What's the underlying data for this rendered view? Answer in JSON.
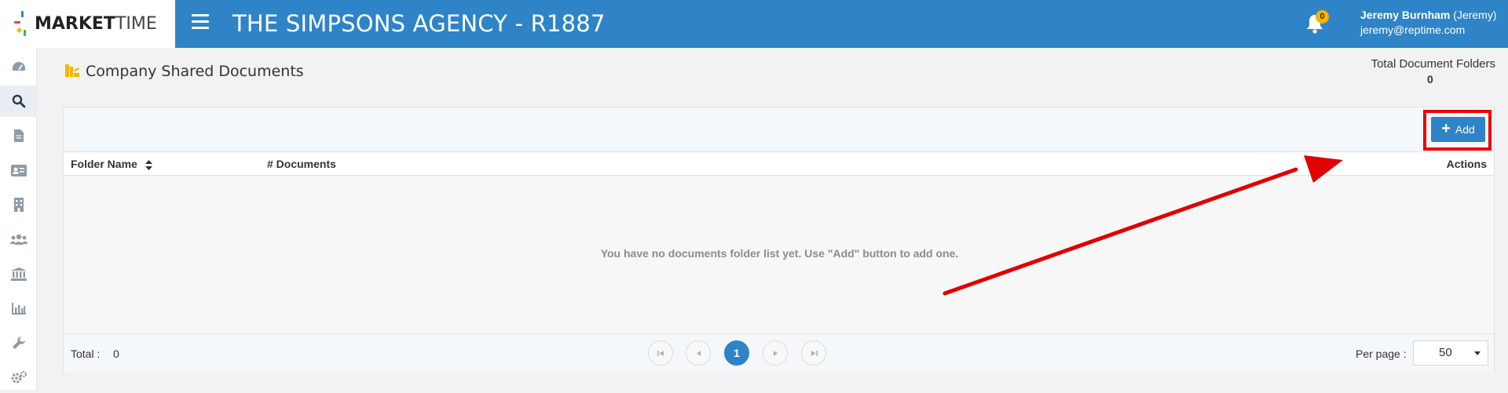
{
  "header": {
    "logo_bold": "MARKET",
    "logo_light": "TIME",
    "agency_title": "THE SIMPSONS AGENCY - R1887",
    "notification_count": "0",
    "user_name": "Jeremy Burnham",
    "user_nickname": "(Jeremy)",
    "user_email": "jeremy@reptime.com"
  },
  "sidebar": {
    "items": [
      {
        "icon": "dashboard-icon"
      },
      {
        "icon": "search-icon",
        "active": true
      },
      {
        "icon": "document-icon"
      },
      {
        "icon": "contact-card-icon"
      },
      {
        "icon": "building-icon"
      },
      {
        "icon": "users-icon"
      },
      {
        "icon": "bank-icon"
      },
      {
        "icon": "bar-chart-icon"
      },
      {
        "icon": "wrench-icon"
      },
      {
        "icon": "gears-icon"
      }
    ]
  },
  "page": {
    "title": "Company Shared Documents",
    "totals_label": "Total Document Folders",
    "totals_value": "0"
  },
  "toolbar": {
    "add_label": "Add"
  },
  "table": {
    "columns": {
      "folder_name": "Folder Name",
      "documents": "# Documents",
      "actions": "Actions"
    },
    "empty_message": "You have no documents folder list yet. Use \"Add\" button to add one."
  },
  "footer": {
    "total_label": "Total :",
    "total_value": "0",
    "current_page": "1",
    "per_page_label": "Per page :",
    "per_page_value": "50"
  },
  "colors": {
    "brand_blue": "#2e84c6",
    "badge_yellow": "#f5b400",
    "annotation_red": "#e00000"
  }
}
